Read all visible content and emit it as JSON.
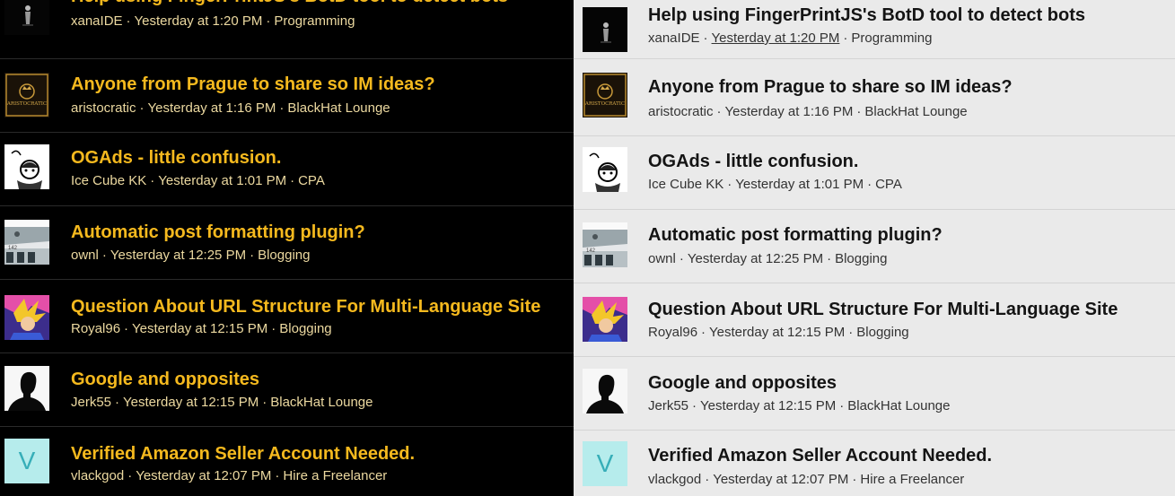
{
  "threads": [
    {
      "title": "Help using FingerPrintJS's BotD tool to detect bots",
      "author": "xanaIDE",
      "time": "Yesterday at 1:20 PM",
      "forum": "Programming",
      "avatar": "dark-figure-avatar"
    },
    {
      "title": "Anyone from Prague to share so IM ideas?",
      "author": "aristocratic",
      "time": "Yesterday at 1:16 PM",
      "forum": "BlackHat Lounge",
      "avatar": "aristocratic-logo-avatar",
      "avatar_text": "ARISTOCRATIC"
    },
    {
      "title": "OGAds - little confusion.",
      "author": "Ice Cube KK",
      "time": "Yesterday at 1:01 PM",
      "forum": "CPA",
      "avatar": "cartoon-character-avatar"
    },
    {
      "title": "Automatic post formatting plugin?",
      "author": "ownl",
      "time": "Yesterday at 12:25 PM",
      "forum": "Blogging",
      "avatar": "building-photo-avatar"
    },
    {
      "title": "Question About URL Structure For Multi-Language Site",
      "author": "Royal96",
      "time": "Yesterday at 12:15 PM",
      "forum": "Blogging",
      "avatar": "anime-character-avatar"
    },
    {
      "title": "Google and opposites",
      "author": "Jerk55",
      "time": "Yesterday at 12:15 PM",
      "forum": "BlackHat Lounge",
      "avatar": "silhouette-avatar"
    },
    {
      "title": "Verified Amazon Seller Account Needed.",
      "author": "vlackgod",
      "time": "Yesterday at 12:07 PM",
      "forum": "Hire a Freelancer",
      "avatar": "letter-avatar",
      "avatar_letter": "V"
    }
  ],
  "colors": {
    "dark_bg": "#000000",
    "dark_title": "#f5b91e",
    "light_bg": "#eaeaea",
    "light_title": "#141414",
    "letter_avatar_bg": "#b6ecec",
    "letter_avatar_fg": "#36aeb8"
  }
}
